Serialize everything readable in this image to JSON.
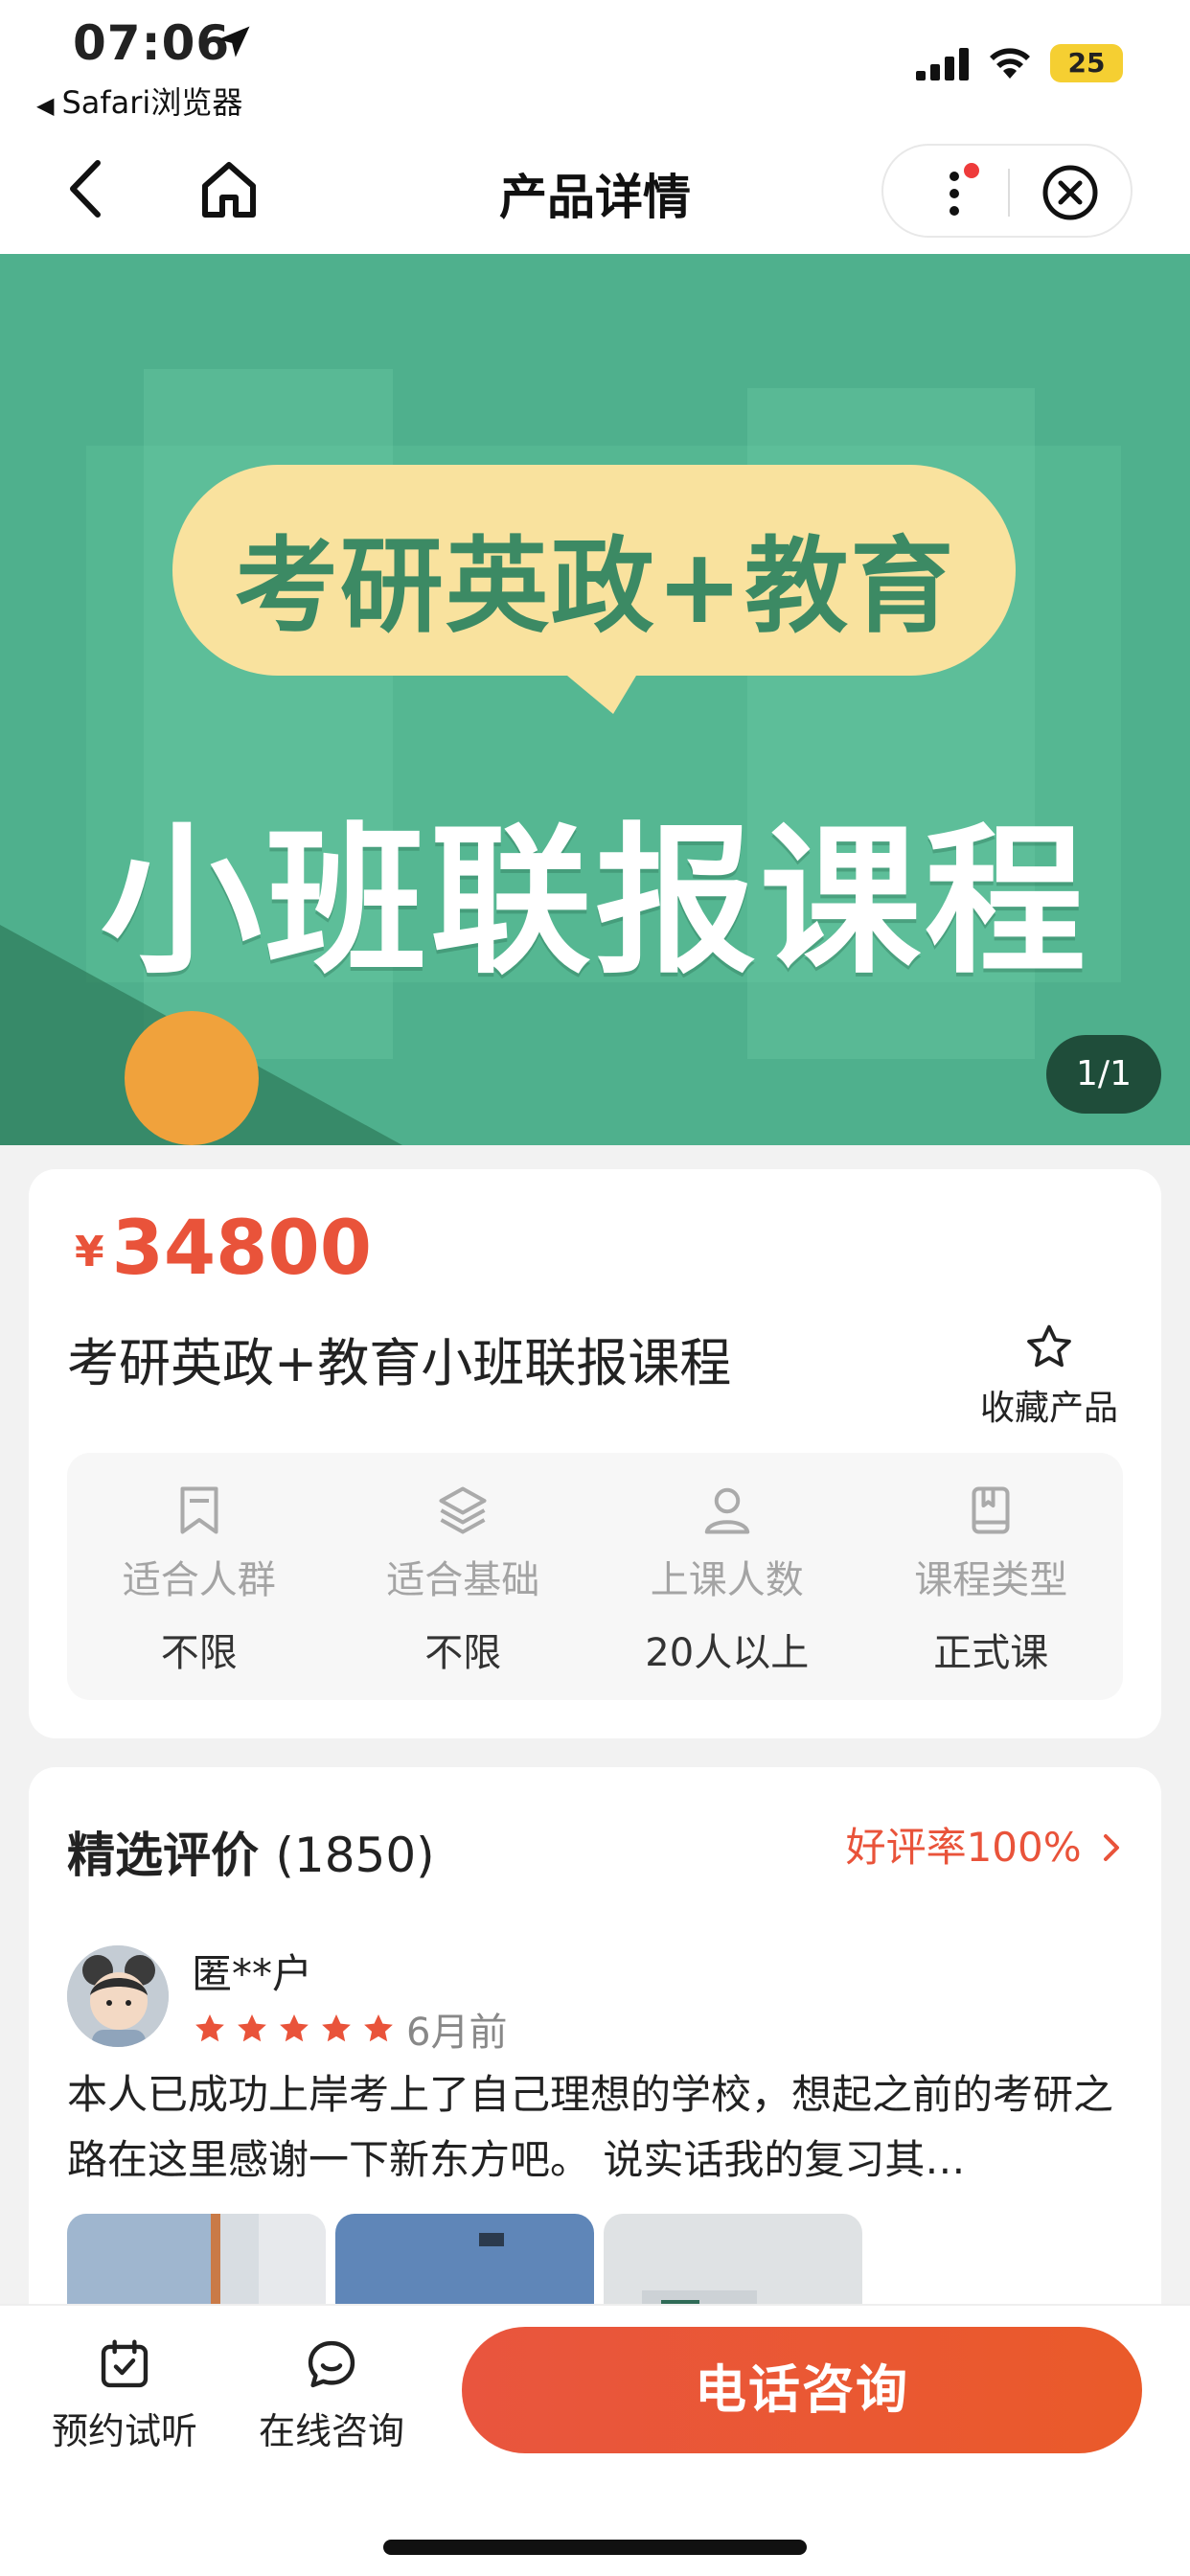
{
  "status_bar": {
    "time": "07:06",
    "back_app": "Safari浏览器",
    "battery": "25",
    "battery_color": "#f5cf32"
  },
  "nav": {
    "title": "产品详情"
  },
  "banner": {
    "title_line1": "考研英政+教育",
    "title_line2": "小班联报课程",
    "page_indicator": "1/1",
    "bg_color": "#4fb08d"
  },
  "product": {
    "currency": "¥",
    "price": "34800",
    "name": "考研英政+教育小班联报课程",
    "favorite_label": "收藏产品",
    "accent_color": "#e9533a",
    "attributes": [
      {
        "icon": "bookmark-icon",
        "label": "适合人群",
        "value": "不限"
      },
      {
        "icon": "layers-icon",
        "label": "适合基础",
        "value": "不限"
      },
      {
        "icon": "person-icon",
        "label": "上课人数",
        "value": "20人以上"
      },
      {
        "icon": "book-icon",
        "label": "课程类型",
        "value": "正式课"
      }
    ]
  },
  "reviews": {
    "title": "精选评价",
    "count": "(1850)",
    "rating_link": "好评率100%",
    "items": [
      {
        "user": "匿**户",
        "stars": 5,
        "time": "6月前",
        "text": "本人已成功上岸考上了自己理想的学校，想起之前的考研之路在这里感谢一下新东方吧。 说实话我的复习其…"
      }
    ]
  },
  "bottom_bar": {
    "trial_label": "预约试听",
    "chat_label": "在线咨询",
    "call_label": "电话咨询"
  }
}
